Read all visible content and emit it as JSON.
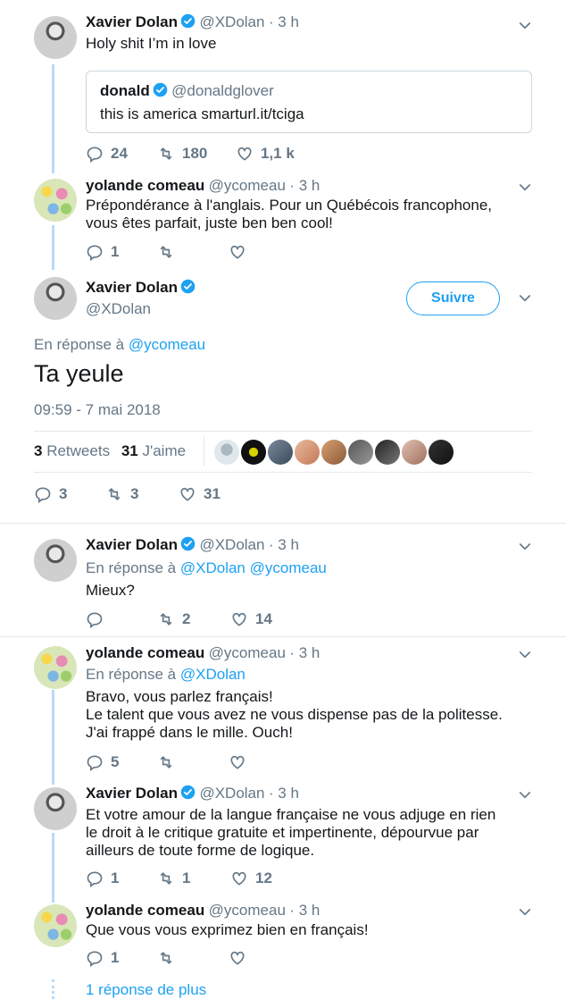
{
  "tweet1": {
    "name": "Xavier Dolan",
    "handle": "@XDolan",
    "time": "· 3 h",
    "text": "Holy shit I’m in love",
    "quote": {
      "name": "donald",
      "handle": "@donaldglover",
      "text": "this is america smarturl.it/tciga"
    },
    "replies": "24",
    "retweets": "180",
    "likes": "1,1 k"
  },
  "tweet2": {
    "name": "yolande comeau",
    "handle": "@ycomeau",
    "time": "· 3 h",
    "text1": "Prépondérance à l'anglais.  Pour un Québécois francophone,",
    "text2": "vous êtes parfait, juste ben ben cool!",
    "replies": "1",
    "retweets": "",
    "likes": ""
  },
  "main": {
    "name": "Xavier Dolan",
    "handle": "@XDolan",
    "follow_label": "Suivre",
    "reply_prefix": "En réponse à",
    "reply_handle": "@ycomeau",
    "text": "Ta yeule",
    "timestamp": "09:59 - 7 mai 2018",
    "retweets_count": "3",
    "retweets_label": "Retweets",
    "likes_count": "31",
    "likes_label": "J'aime",
    "replies": "3",
    "retweets": "3",
    "likes": "31"
  },
  "tweet3": {
    "name": "Xavier Dolan",
    "handle": "@XDolan",
    "time": "· 3 h",
    "reply_prefix": "En réponse à",
    "reply_handles": "@XDolan @ycomeau",
    "text": "Mieux?",
    "replies": "",
    "retweets": "2",
    "likes": "14"
  },
  "tweet4": {
    "name": "yolande comeau",
    "handle": "@ycomeau",
    "time": "· 3 h",
    "reply_prefix": "En réponse à",
    "reply_handle": "@XDolan",
    "text1": "Bravo, vous parlez français!",
    "text2": "Le talent que vous avez ne vous dispense pas de la politesse.",
    "text3": "J'ai frappé dans le mille. Ouch!",
    "replies": "5",
    "retweets": "",
    "likes": ""
  },
  "tweet5": {
    "name": "Xavier Dolan",
    "handle": "@XDolan",
    "time": "· 3 h",
    "text1": "Et votre amour de la langue française ne vous adjuge en rien",
    "text2": "le droit à le critique gratuite et impertinente, dépourvue par",
    "text3": "ailleurs de toute forme de logique.",
    "replies": "1",
    "retweets": "1",
    "likes": "12"
  },
  "tweet6": {
    "name": "yolande comeau",
    "handle": "@ycomeau",
    "time": "· 3 h",
    "text": "Que vous vous exprimez bien en français!",
    "replies": "1",
    "retweets": "",
    "likes": ""
  },
  "more_replies": "1 réponse de plus",
  "colors": {
    "accent": "#1da1f2",
    "thread": "#b8dbf5",
    "muted": "#657786"
  }
}
